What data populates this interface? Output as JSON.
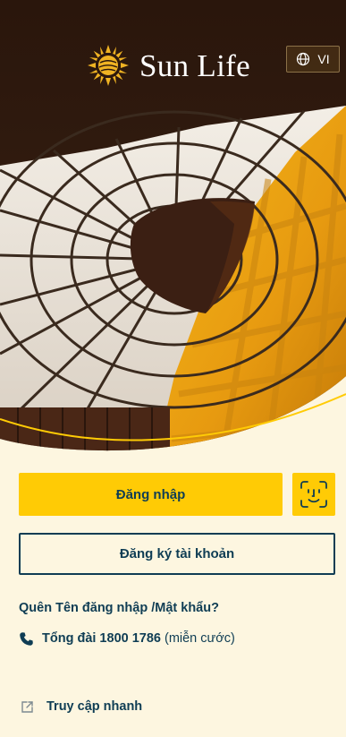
{
  "brand": {
    "name": "Sun Life",
    "logo_icon": "sun-icon",
    "accent_color": "#ffcb05",
    "text_color": "#0f3d54",
    "background_color": "#fdf6e0"
  },
  "language_toggle": {
    "icon": "globe-icon",
    "label": "VI"
  },
  "actions": {
    "login_label": "Đăng nhập",
    "face_login_icon": "face-id-icon",
    "register_label": "Đăng ký tài khoản"
  },
  "links": {
    "forgot_label": "Quên Tên đăng nhập /Mật khẩu?",
    "hotline_icon": "phone-icon",
    "hotline_label": "Tổng đài 1800 1786",
    "hotline_note": "(miễn cước)",
    "quick_access_icon": "external-link-icon",
    "quick_access_label": "Truy cập nhanh"
  }
}
